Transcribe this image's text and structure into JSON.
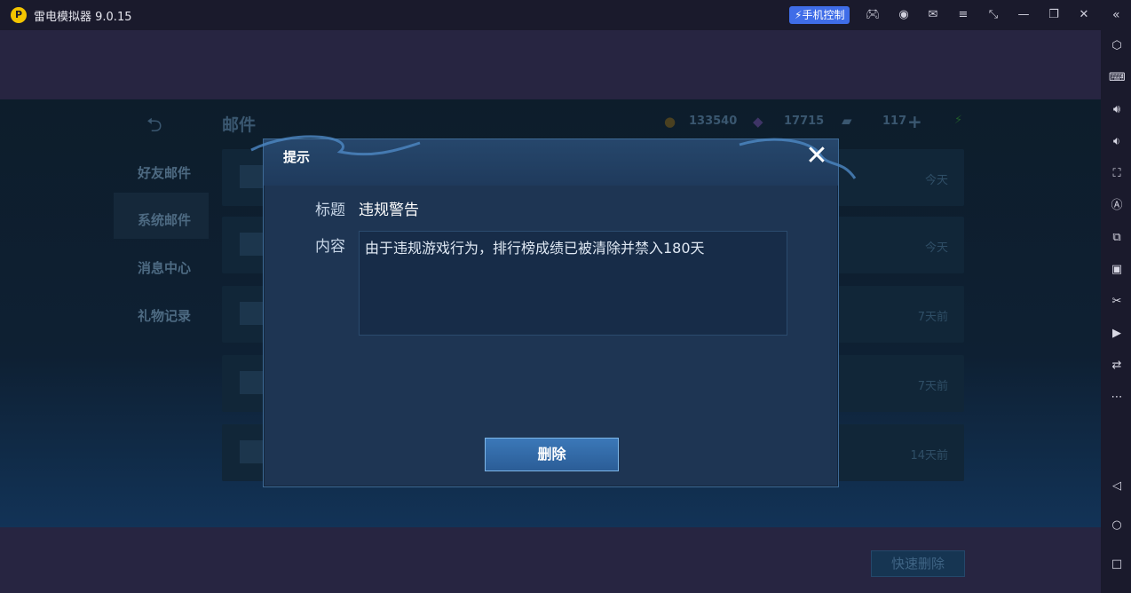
{
  "titlebar": {
    "app_title": "雷电模拟器 9.0.15",
    "logo_glyph": "P",
    "phone_control": "手机控制",
    "icons": [
      "gamepad-icon",
      "user-icon",
      "mail-icon",
      "menu-icon",
      "resize-icon",
      "minimize-icon",
      "restore-icon",
      "close-icon"
    ]
  },
  "sidebar": {
    "icons": [
      "settings-icon",
      "keyboard-icon",
      "volume-up-icon",
      "volume-down-icon",
      "screenshot-icon",
      "auto-icon",
      "multi-instance-icon",
      "apk-icon",
      "scissors-icon",
      "video-icon",
      "sync-icon",
      "more-icon",
      "back-icon",
      "home-icon",
      "recent-apps-icon"
    ]
  },
  "game": {
    "page_title": "邮件",
    "gold": "133540",
    "diamonds": "17715",
    "tickets": "117",
    "tabs": [
      "好友邮件",
      "系统邮件",
      "消息中心",
      "礼物记录"
    ],
    "rows": [
      {
        "date": "今天"
      },
      {
        "date": "今天"
      },
      {
        "date": "7天前"
      },
      {
        "date": "7天前"
      },
      {
        "date": "14天前"
      }
    ],
    "quick_delete": "快速删除"
  },
  "dialog": {
    "title": "提示",
    "close_glyph": "✕",
    "subject_label": "标题",
    "subject_value": "违规警告",
    "content_label": "内容",
    "content_value": "由于违规游戏行为，排行榜成绩已被清除并禁入180天",
    "delete_label": "删除"
  },
  "colors": {
    "accent": "#3f6de8",
    "dialog_bg": "#1e3553",
    "button_blue": "#3b78b8"
  }
}
